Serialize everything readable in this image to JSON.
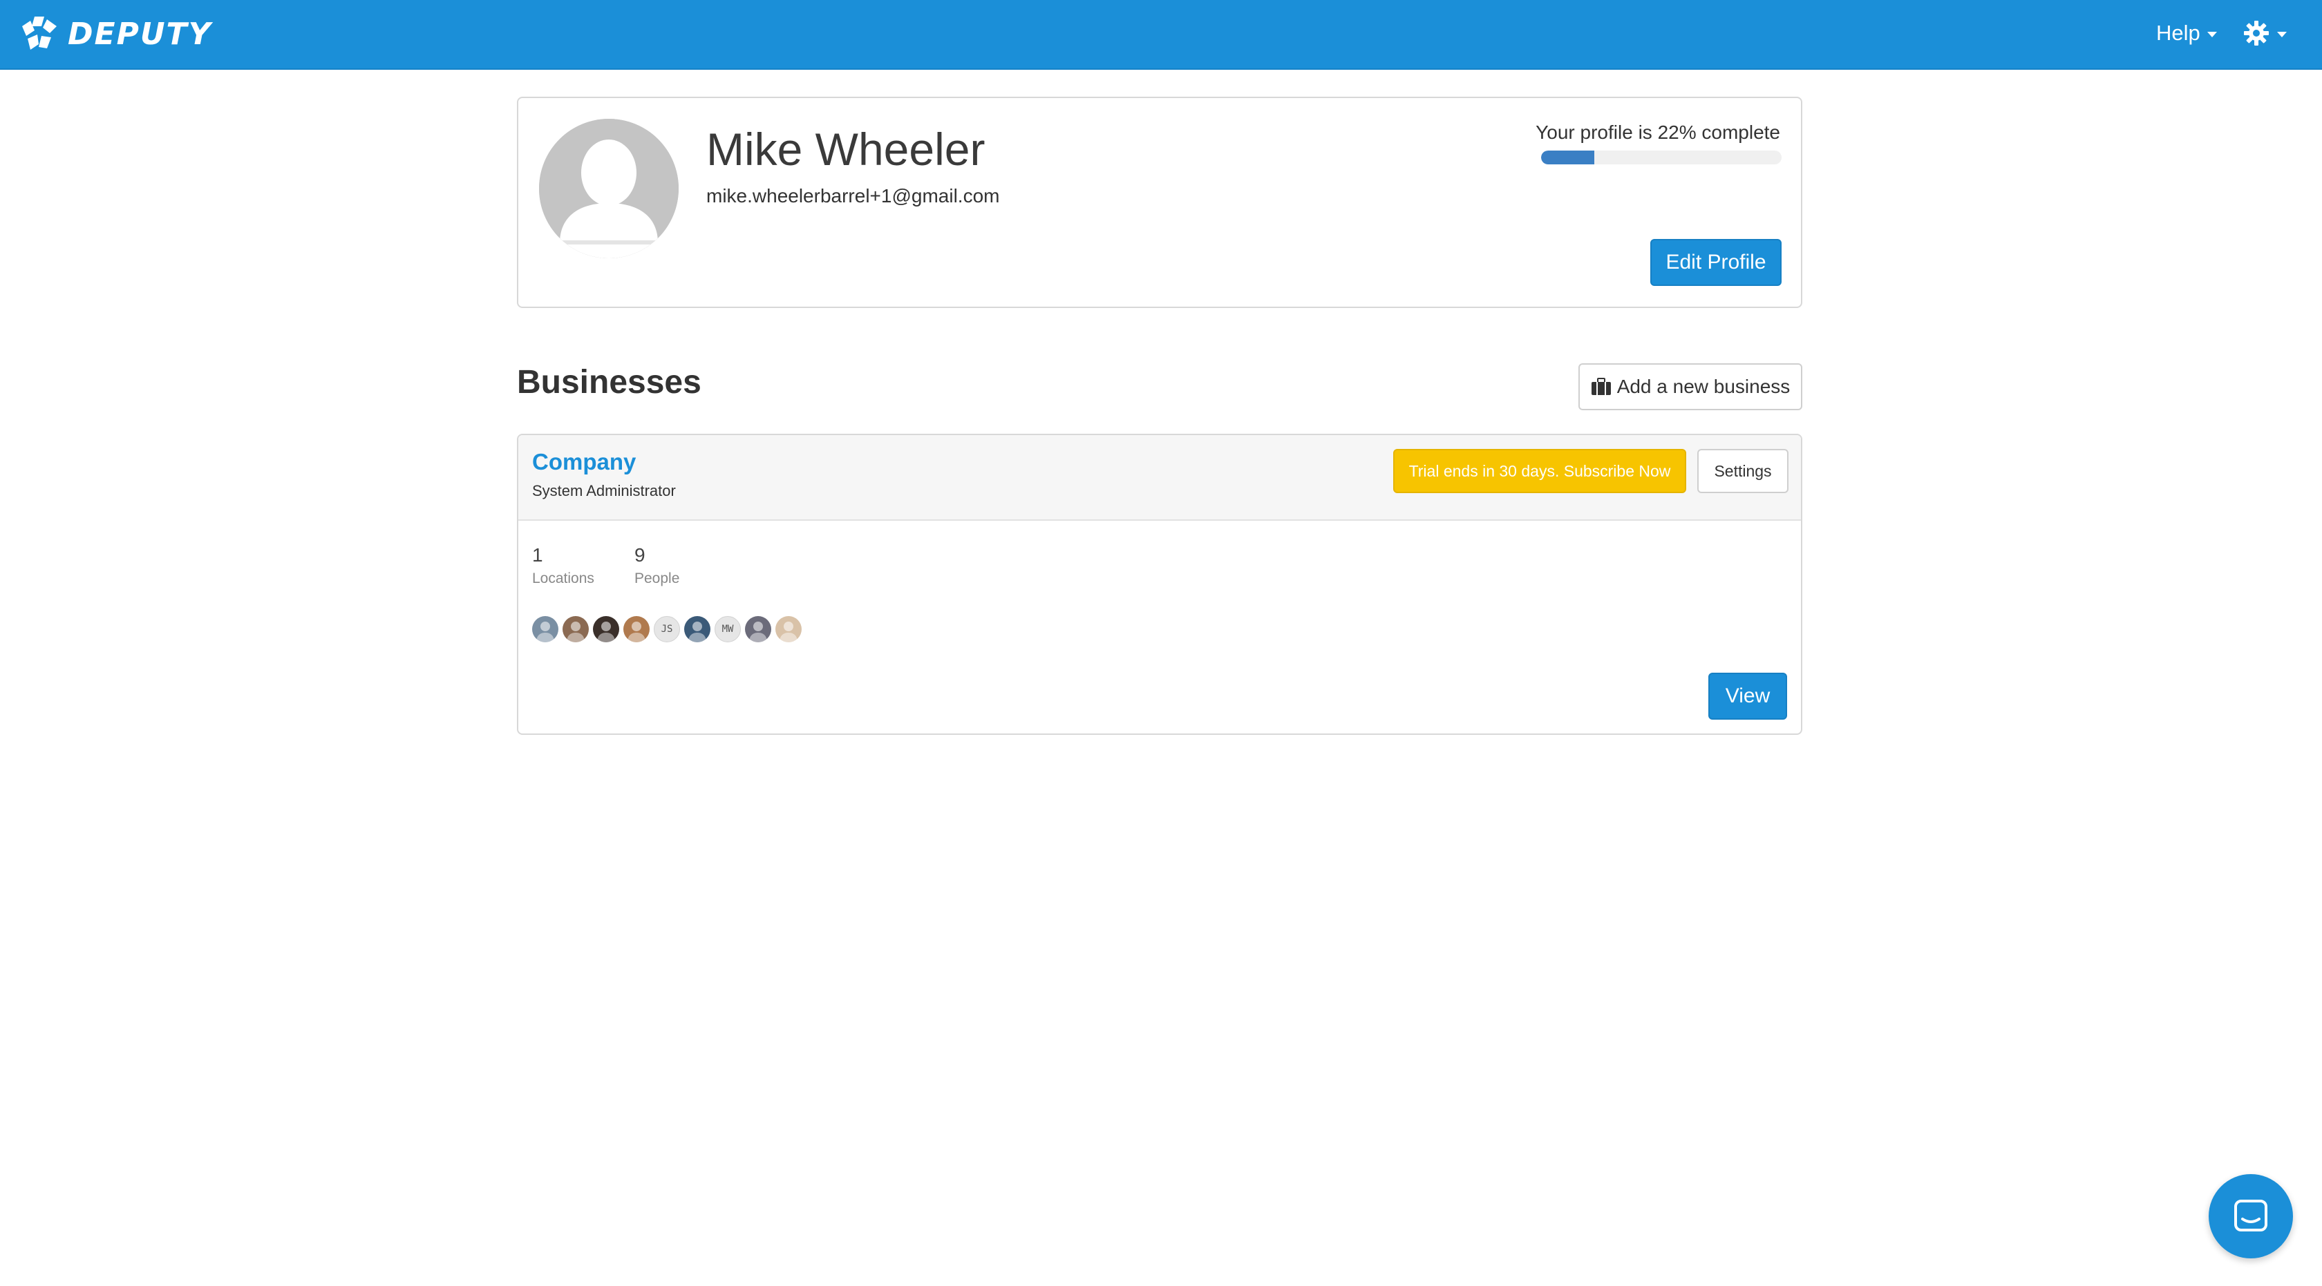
{
  "app": {
    "brand": "DEPUTY",
    "accent_color": "#1b8fd8"
  },
  "nav": {
    "help_label": "Help",
    "settings_icon": "gear-icon"
  },
  "profile": {
    "name": "Mike Wheeler",
    "email": "mike.wheelerbarrel+1@gmail.com",
    "completion_text": "Your profile is 22% complete",
    "completion_percent": 22,
    "edit_label": "Edit Profile"
  },
  "businesses": {
    "title": "Businesses",
    "add_label": "Add a new business",
    "items": [
      {
        "name": "Company",
        "role": "System Administrator",
        "trial_label": "Trial ends in 30 days. Subscribe Now",
        "settings_label": "Settings",
        "locations_count": "1",
        "locations_label": "Locations",
        "people_count": "9",
        "people_label": "People",
        "avatars": [
          {
            "type": "photo",
            "color": "#7a8fa3"
          },
          {
            "type": "photo",
            "color": "#8b6a52"
          },
          {
            "type": "photo",
            "color": "#3a2f2a"
          },
          {
            "type": "photo",
            "color": "#b07a4e"
          },
          {
            "type": "initials",
            "text": "JS"
          },
          {
            "type": "photo",
            "color": "#3b5a78"
          },
          {
            "type": "initials",
            "text": "MW"
          },
          {
            "type": "photo",
            "color": "#6b6b7a"
          },
          {
            "type": "photo",
            "color": "#d9c2a8"
          }
        ],
        "view_label": "View"
      }
    ]
  }
}
